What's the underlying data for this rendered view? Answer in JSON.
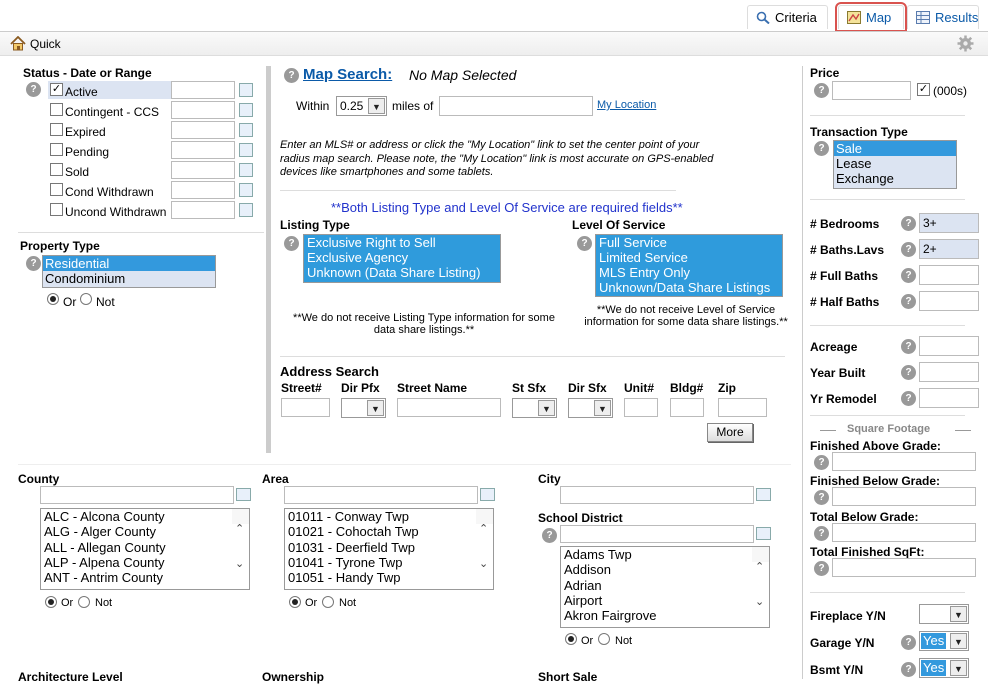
{
  "tabs": {
    "criteria": "Criteria",
    "map": "Map",
    "results": "Results"
  },
  "quick": {
    "label": "Quick"
  },
  "status": {
    "title": "Status - Date or Range",
    "items": [
      {
        "label": "Active",
        "checked": true
      },
      {
        "label": "Contingent - CCS",
        "checked": false
      },
      {
        "label": "Expired",
        "checked": false
      },
      {
        "label": "Pending",
        "checked": false
      },
      {
        "label": "Sold",
        "checked": false
      },
      {
        "label": "Cond Withdrawn",
        "checked": false
      },
      {
        "label": "Uncond Withdrawn",
        "checked": false
      }
    ]
  },
  "property_type": {
    "title": "Property Type",
    "options": [
      "Residential",
      "Condominium"
    ],
    "selected": "Residential",
    "or": "Or",
    "not": "Not"
  },
  "map_search": {
    "title": "Map Search:",
    "status": "No Map Selected",
    "within": "Within",
    "miles_value": "0.25",
    "miles_of": "miles of",
    "my_location": "My Location",
    "instructions": "Enter an MLS# or address or click the \"My Location\" link to set the center point of your radius map search. Please note, the \"My Location\" link is most accurate on GPS-enabled devices like smartphones and some tablets.",
    "required_note": "**Both Listing Type and Level Of Service are required fields**"
  },
  "listing_type": {
    "title": "Listing Type",
    "options": [
      "Exclusive Right to Sell",
      "Exclusive Agency",
      "Unknown (Data Share Listing)"
    ],
    "note": "**We do not receive Listing Type information for some data share listings.**"
  },
  "level_of_service": {
    "title": "Level Of Service",
    "options": [
      "Full Service",
      "Limited Service",
      "MLS Entry Only",
      "Unknown/Data Share Listings"
    ],
    "note": "**We do not receive Level of Service information for some data share listings.**"
  },
  "address_search": {
    "title": "Address Search",
    "columns": [
      "Street#",
      "Dir Pfx",
      "Street Name",
      "St Sfx",
      "Dir Sfx",
      "Unit#",
      "Bldg#",
      "Zip"
    ],
    "more_button": "More"
  },
  "price": {
    "title": "Price",
    "units": "(000s)"
  },
  "transaction_type": {
    "title": "Transaction Type",
    "options": [
      "Sale",
      "Lease",
      "Exchange"
    ],
    "selected": "Sale"
  },
  "right_fields": [
    {
      "label": "# Bedrooms",
      "value": "3+"
    },
    {
      "label": "# Baths.Lavs",
      "value": "2+"
    },
    {
      "label": "# Full Baths",
      "value": ""
    },
    {
      "label": "# Half Baths",
      "value": ""
    },
    {
      "label": "Acreage",
      "value": ""
    },
    {
      "label": "Year Built",
      "value": ""
    },
    {
      "label": "Yr Remodel",
      "value": ""
    }
  ],
  "square_footage": {
    "title": "Square Footage",
    "fields": [
      "Finished Above Grade:",
      "Finished Below Grade:",
      "Total Below Grade:",
      "Total Finished SqFt:"
    ]
  },
  "yn_fields": [
    {
      "label": "Fireplace Y/N",
      "value": ""
    },
    {
      "label": "Garage Y/N",
      "value": "Yes"
    },
    {
      "label": "Bsmt Y/N",
      "value": "Yes"
    }
  ],
  "county": {
    "title": "County",
    "items": [
      "ALC - Alcona County",
      "ALG - Alger County",
      "ALL - Allegan County",
      "ALP - Alpena County",
      "ANT - Antrim County"
    ],
    "or": "Or",
    "not": "Not"
  },
  "area": {
    "title": "Area",
    "items": [
      "01011 - Conway Twp",
      "01021 - Cohoctah Twp",
      "01031 - Deerfield Twp",
      "01041 - Tyrone Twp",
      "01051 - Handy Twp"
    ],
    "or": "Or",
    "not": "Not"
  },
  "city": {
    "title": "City"
  },
  "school_district": {
    "title": "School District",
    "items": [
      "Adams Twp",
      "Addison",
      "Adrian",
      "Airport",
      "Akron Fairgrove"
    ],
    "or": "Or",
    "not": "Not"
  },
  "bottom_labels": [
    "Architecture Level",
    "Ownership",
    "Short Sale"
  ],
  "colors": {
    "highlight_red": "#d9534f",
    "selection_blue": "#3399dd",
    "link_blue": "#0b5aa8",
    "required_blue": "#2233cc"
  }
}
